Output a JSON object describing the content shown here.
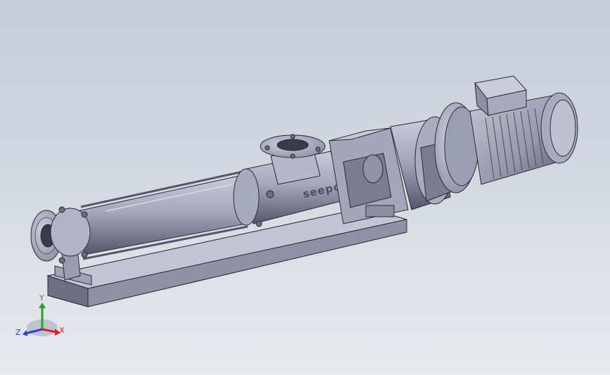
{
  "model": {
    "brand_marking": "seepox"
  },
  "triad": {
    "labels": {
      "x": "X",
      "y": "Y",
      "z": "Z"
    },
    "colors": {
      "x": "#e02020",
      "y": "#1fa51f",
      "z": "#2a3fd6"
    }
  },
  "palette": {
    "metal_light": "#b9bccd",
    "metal_mid": "#9a9cb0",
    "metal_dark": "#5a5b6c",
    "edge": "#2b2b33"
  }
}
